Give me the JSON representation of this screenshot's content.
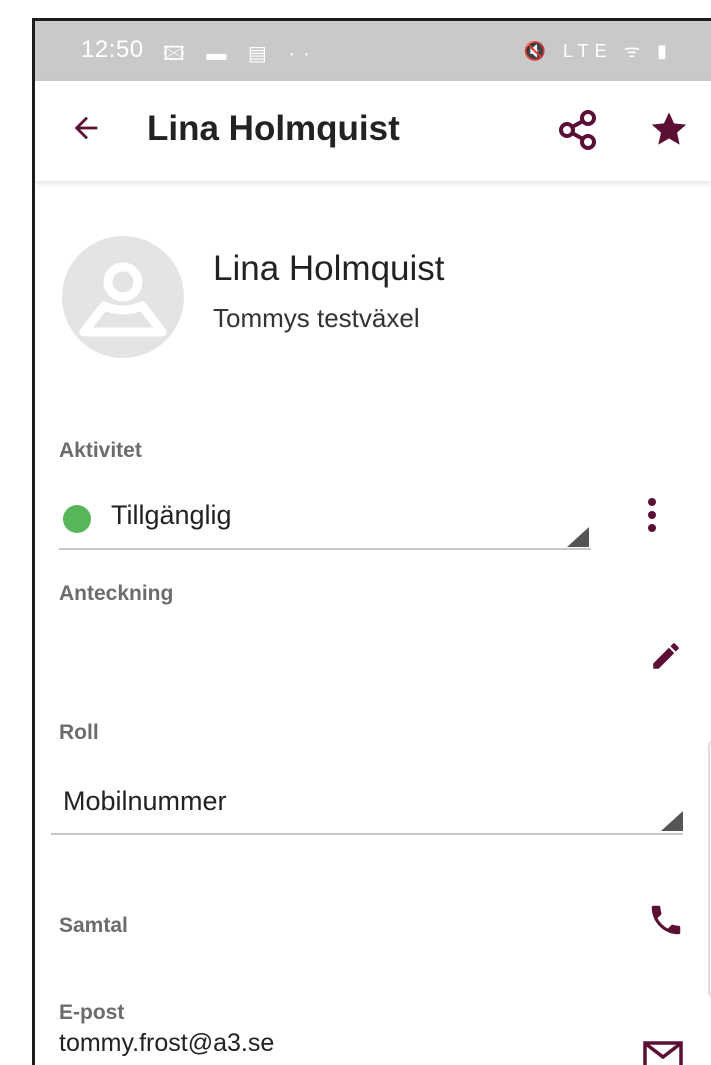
{
  "status_bar": {
    "time": "12:50",
    "left_icons": "🖾 ▬ ▤ ··",
    "right_icons": "🔇 LTE ᯤ ▮"
  },
  "app_bar": {
    "title": "Lina Holmquist",
    "back_icon": "arrow-left-icon",
    "share_icon": "share-icon",
    "favorite_icon": "star-icon"
  },
  "profile": {
    "name": "Lina Holmquist",
    "company": "Tommys testväxel"
  },
  "activity": {
    "label": "Aktivitet",
    "value": "Tillgänglig",
    "status_color": "#55b65a"
  },
  "note": {
    "label": "Anteckning"
  },
  "role": {
    "label": "Roll",
    "value": "Mobilnummer"
  },
  "call": {
    "label": "Samtal"
  },
  "email": {
    "label": "E-post",
    "value": "tommy.frost@a3.se"
  },
  "theme": {
    "accent": "#5b0f35",
    "status_bar_bg": "#c9c9c9"
  }
}
